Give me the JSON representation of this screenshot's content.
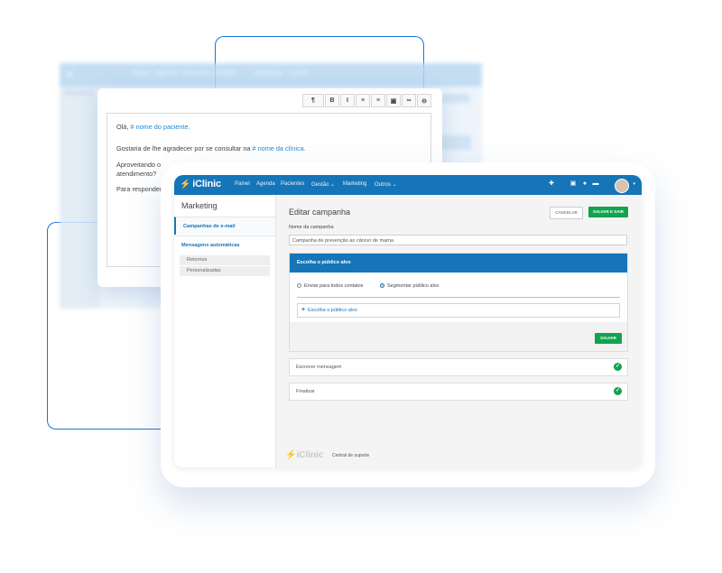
{
  "back_window": {
    "brand": "iC",
    "nav": [
      "Painel",
      "Agenda",
      "Pacientes",
      "Gestão",
      "Marketing",
      "Outros"
    ],
    "sidebar_title": "Marketing"
  },
  "editor": {
    "toolbar": [
      "¶",
      "B",
      "I",
      "≡",
      "≡",
      "▣",
      "∞",
      "⊖"
    ],
    "greeting_prefix": "Olá,",
    "greeting_tag": "# nome do paciente.",
    "thanks_prefix": "Gostaria de lhe agradecer por se consultar na",
    "thanks_tag": "# nome da clínica.",
    "line3": "Aproveitando o",
    "line4": "atendimento?",
    "line5": "Para responder"
  },
  "app": {
    "brand": "iClinic",
    "nav": [
      "Painel",
      "Agenda",
      "Pacientes",
      "Gestão ⌄",
      "Marketing",
      "Outros ⌄"
    ],
    "icons": [
      "plus-circle-icon",
      "calendar-icon",
      "drop-icon",
      "chat-icon"
    ]
  },
  "sidebar": {
    "title": "Marketing",
    "items": [
      "Campanhas de e-mail",
      "Mensagens automáticas"
    ],
    "subitems": [
      "Retornos",
      "Personalizadas"
    ]
  },
  "main": {
    "title": "Editar campanha",
    "cancel_label": "CANCELAR",
    "save_exit_label": "SALVAR E SAIR",
    "name_label": "Nome da campanha",
    "name_value": "Campanha de prevenção ao câncer de mama",
    "audience_title": "Escolha o público alvo",
    "radio_all": "Enviar para todos contatos",
    "radio_segment": "Segmentar público alvo",
    "choose_label": "Escolha o público alvo",
    "save_label": "SALVAR",
    "step_write": "Escrever mensagem",
    "step_finish": "Finalizar"
  },
  "footer": {
    "brand": "iClinic",
    "support": "Central de suporte"
  },
  "colors": {
    "primary": "#1575b8",
    "success": "#11a34e",
    "accent_line": "#1a73d9"
  }
}
